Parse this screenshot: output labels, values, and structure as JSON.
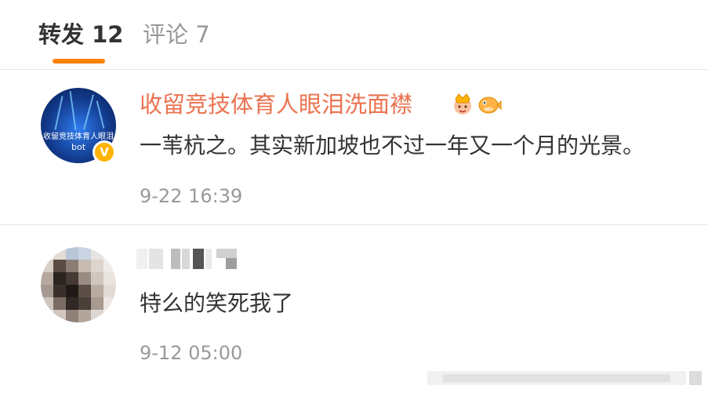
{
  "tabs": {
    "repost": "转发 12",
    "comments": "评论 7"
  },
  "comments": [
    {
      "username": "收留竞技体育人眼泪洗面襟",
      "avatar_text": "收留竞技体育人眼泪",
      "avatar_sub": "bot",
      "text": "一苇杭之。其实新加坡也不过一年又一个月的光景。",
      "time": "9-22 16:39"
    },
    {
      "text": "特么的笑死我了",
      "time": "9-12 05:00"
    }
  ],
  "colors": {
    "accent": "#ff8200",
    "username": "#eb7350",
    "text": "#333333",
    "muted": "#999999",
    "verified": "#ffb400"
  },
  "icons": {
    "verified": "verified-v-icon",
    "crown": "crown-icon",
    "fish": "pufferfish-icon"
  }
}
